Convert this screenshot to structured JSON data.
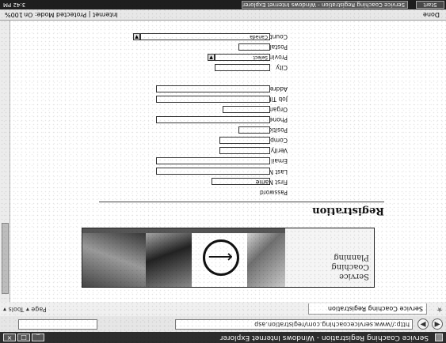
{
  "window": {
    "title": "Service Coaching Registration - Windows Internet Explorer",
    "buttons": {
      "minimize": "_",
      "maximize": "□",
      "close": "×"
    }
  },
  "nav": {
    "address": "http://www.servicecoaching.com/registration.asp",
    "back_icon": "back-arrow-icon",
    "forward_icon": "forward-arrow-icon"
  },
  "tab": {
    "label": "Service Coaching Registration",
    "tools": "Page ▾  Tools ▾"
  },
  "banner": {
    "logo_line1": "Service",
    "logo_line2": "Coaching",
    "logo_line3": "Planning"
  },
  "page": {
    "heading": "Registration"
  },
  "form": {
    "fields": [
      {
        "label": "Password"
      },
      {
        "label": "First Name"
      },
      {
        "label": "Last Name"
      },
      {
        "label": "Email"
      },
      {
        "label": "Verify Email"
      },
      {
        "label": "Company"
      },
      {
        "label": "Position Title"
      },
      {
        "label": "Phone Number"
      },
      {
        "label": "Organization"
      },
      {
        "label": "Job Title"
      },
      {
        "label": "Address"
      },
      {
        "label": "City"
      },
      {
        "label": "Province"
      },
      {
        "label": "Postal Code"
      },
      {
        "label": "Country"
      }
    ],
    "province_value": "Select",
    "country_value": "Canada"
  },
  "status": {
    "text": "Done",
    "zone": "Internet | Protected Mode: On",
    "zoom": "100%"
  },
  "taskbar": {
    "start": "Start",
    "task": "Service Coaching Registration - Windows Internet Explorer",
    "clock": "3:42 PM"
  }
}
